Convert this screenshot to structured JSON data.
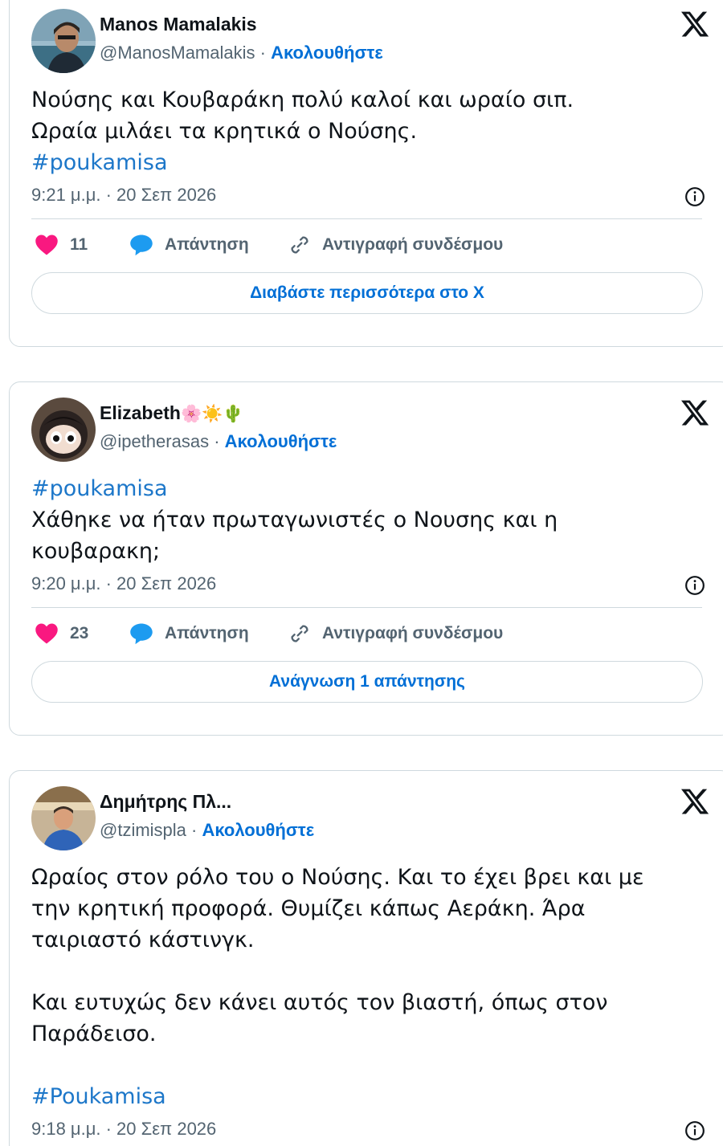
{
  "tweets": [
    {
      "name": "Manos Mamalakis",
      "handle": "@ManosMamalakis",
      "follow_label": "Ακολουθήστε",
      "text": "Νούσης και Κουβαράκη πολύ καλοί και ωραίο σιπ.\nΩραία μιλάει τα κρητικά ο Νούσης.",
      "hashtag": "#poukamisa",
      "time": "9:21 μ.μ. · 20 Σεπ 2026",
      "likes": "11",
      "reply_label": "Απάντηση",
      "copy_label": "Αντιγραφή συνδέσμου",
      "cta_label": "Διαβάστε περισσότερα στο X"
    },
    {
      "name": "Elizabeth",
      "name_emoji": "🌸☀️🌵",
      "handle": "@ipetherasas",
      "follow_label": "Ακολουθήστε",
      "hashtag": "#poukamisa",
      "text": "Χάθηκε να ήταν πρωταγωνιστές ο Νουσης και η\nκουβαρακη;",
      "time": "9:20 μ.μ. · 20 Σεπ 2026",
      "likes": "23",
      "reply_label": "Απάντηση",
      "copy_label": "Αντιγραφή συνδέσμου",
      "cta_label": "Ανάγνωση 1 απάντησης"
    },
    {
      "name": "Δημήτρης Πλ...",
      "handle": "@tzimispla",
      "follow_label": "Ακολουθήστε",
      "text": "Ωραίος στον ρόλο του ο Νούσης. Και το έχει βρει και με\nτην κρητική προφορά. Θυμίζει κάπως Αεράκη. Άρα\nταιριαστό κάστινγκ.\n\nΚαι ευτυχώς δεν κάνει αυτός τον βιαστή, όπως στον\nΠαράδεισο.\n",
      "hashtag": "#Poukamisa",
      "time": "9:18 μ.μ. · 20 Σεπ 2026"
    }
  ],
  "colors": {
    "accent": "#006fd6",
    "hashtag": "#1d77c9",
    "like": "#f91880",
    "reply": "#1d9bf0",
    "border": "#cfd9de",
    "muted": "#536471"
  }
}
